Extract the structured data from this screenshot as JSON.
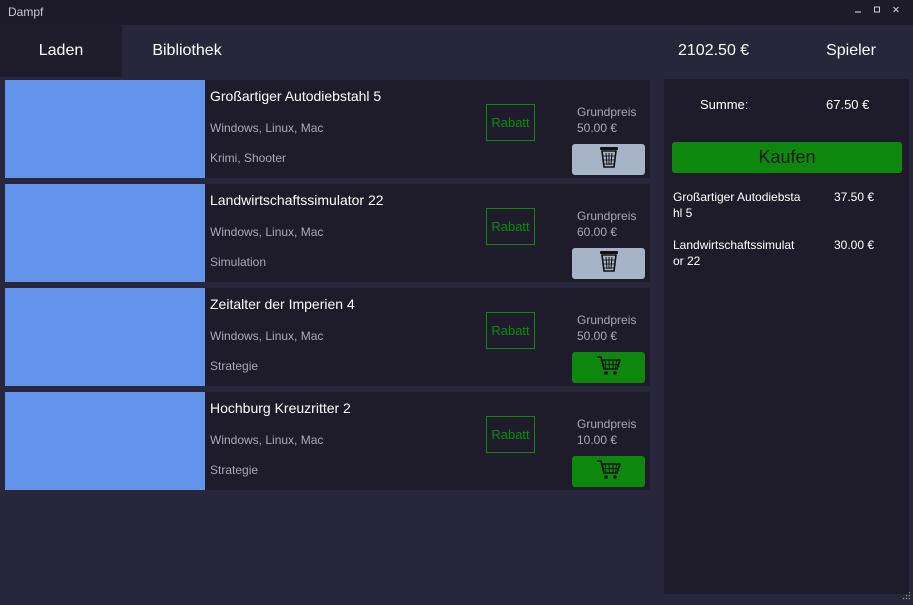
{
  "window": {
    "title": "Dampf",
    "minimize_icon": "minimize-icon",
    "maximize_icon": "maximize-icon",
    "close_icon": "close-icon"
  },
  "nav": {
    "tabs": [
      {
        "label": "Laden"
      },
      {
        "label": "Bibliothek"
      }
    ],
    "balance": "2102.50 €",
    "player_label": "Spieler"
  },
  "games": [
    {
      "title": "Großartiger Autodiebstahl 5",
      "platforms": "Windows, Linux, Mac",
      "genres": "Krimi, Shooter",
      "discount_label": "Rabatt",
      "price_label": "Grundpreis",
      "price": "50.00 €",
      "action": "remove",
      "action_icon": "trash-icon"
    },
    {
      "title": "Landwirtschaftssimulator 22",
      "platforms": "Windows, Linux, Mac",
      "genres": "Simulation",
      "discount_label": "Rabatt",
      "price_label": "Grundpreis",
      "price": "60.00 €",
      "action": "remove",
      "action_icon": "trash-icon"
    },
    {
      "title": "Zeitalter der Imperien 4",
      "platforms": "Windows, Linux, Mac",
      "genres": "Strategie",
      "discount_label": "Rabatt",
      "price_label": "Grundpreis",
      "price": "50.00 €",
      "action": "add",
      "action_icon": "cart-icon"
    },
    {
      "title": "Hochburg Kreuzritter 2",
      "platforms": "Windows, Linux, Mac",
      "genres": "Strategie",
      "discount_label": "Rabatt",
      "price_label": "Grundpreis",
      "price": "10.00 €",
      "action": "add",
      "action_icon": "cart-icon"
    }
  ],
  "cart": {
    "sum_label": "Summe:",
    "sum_value": "67.50 €",
    "buy_label": "Kaufen",
    "items": [
      {
        "name": "Großartiger Autodiebstahl 5",
        "price": "37.50 €"
      },
      {
        "name": "Landwirtschaftssimulator 22",
        "price": "30.00 €"
      }
    ]
  },
  "colors": {
    "background": "#28263a",
    "panel": "#1e1c2b",
    "thumbnail": "#6495ed",
    "accent_green": "#0d880d",
    "remove_button": "#a7b3c6"
  }
}
